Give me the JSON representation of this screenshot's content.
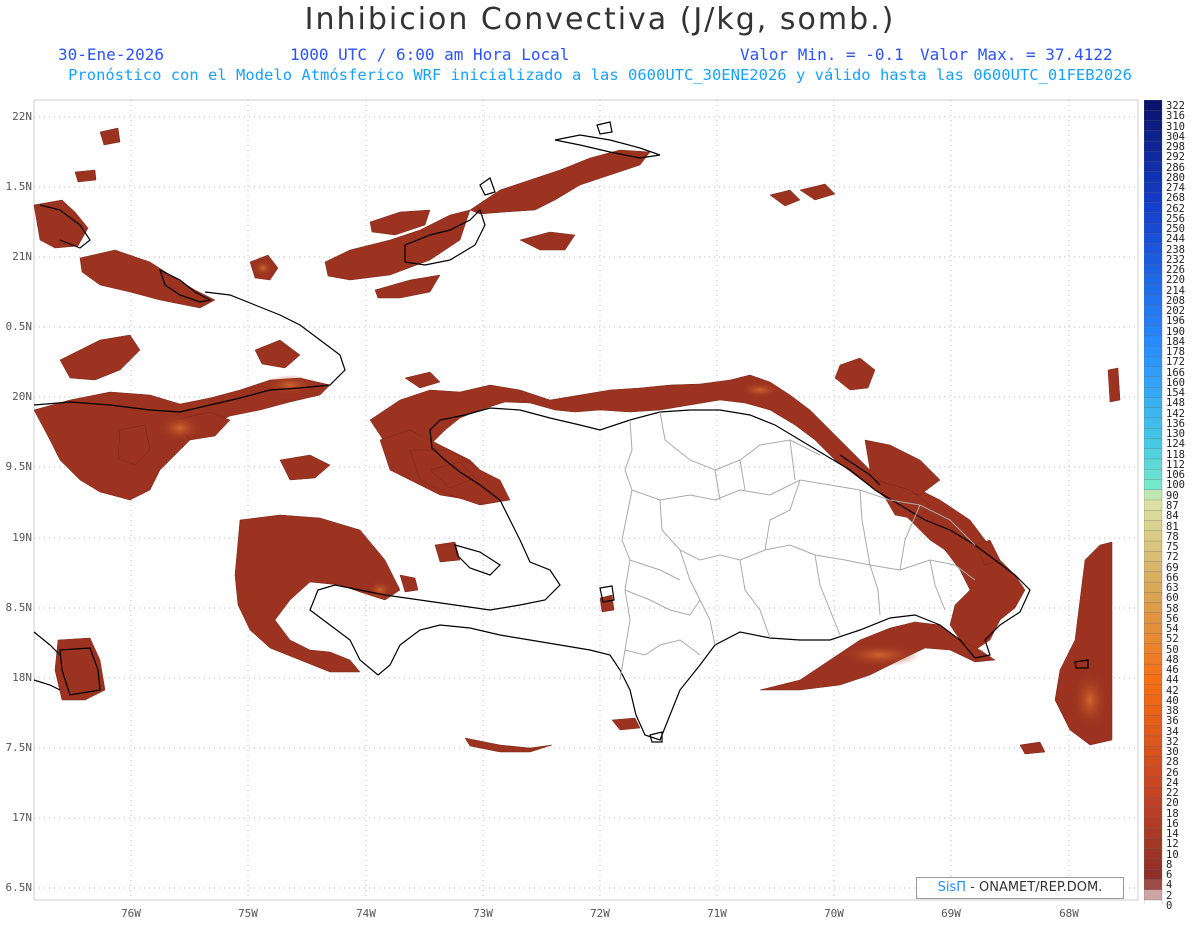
{
  "header": {
    "title": "Inhibicion Convectiva (J/kg, somb.)",
    "date": "30-Ene-2026",
    "time": "1000 UTC / 6:00 am Hora Local",
    "valmin": "Valor Min. = -0.1",
    "valmax": "Valor Max. = 37.4122",
    "forecast": "Pronóstico con el Modelo Atmósferico WRF inicializado a las 0600UTC_30ENE2026 y válido hasta las  0600UTC_01FEB2026"
  },
  "axes": {
    "lat_labels": [
      "22N",
      "1.5N",
      "21N",
      "0.5N",
      "20N",
      "9.5N",
      "19N",
      "8.5N",
      "18N",
      "7.5N",
      "17N",
      "6.5N"
    ],
    "lon_labels": [
      "76W",
      "75W",
      "74W",
      "73W",
      "72W",
      "71W",
      "70W",
      "69W",
      "68W"
    ]
  },
  "colorbar": {
    "labels": [
      "322",
      "316",
      "310",
      "304",
      "298",
      "292",
      "286",
      "280",
      "274",
      "268",
      "262",
      "256",
      "250",
      "244",
      "238",
      "232",
      "226",
      "220",
      "214",
      "208",
      "202",
      "196",
      "190",
      "184",
      "178",
      "172",
      "166",
      "160",
      "154",
      "148",
      "142",
      "136",
      "130",
      "124",
      "118",
      "112",
      "106",
      "100",
      "90",
      "87",
      "84",
      "81",
      "78",
      "75",
      "72",
      "69",
      "66",
      "63",
      "60",
      "58",
      "56",
      "54",
      "52",
      "50",
      "48",
      "46",
      "44",
      "42",
      "40",
      "38",
      "36",
      "34",
      "32",
      "30",
      "28",
      "26",
      "24",
      "22",
      "20",
      "18",
      "16",
      "14",
      "12",
      "10",
      "8",
      "6",
      "4",
      "2",
      "0"
    ]
  },
  "credit": {
    "logo": "SisΠ",
    "text": " - ONAMET/REP.DOM."
  },
  "colors": {
    "shade_dark": "#8b2a1c",
    "shade_mid": "#a3391f",
    "shade_light": "#c65a28",
    "coast": "#000000",
    "provinces": "#aaaaaa",
    "grid": "#bbbbbb"
  }
}
